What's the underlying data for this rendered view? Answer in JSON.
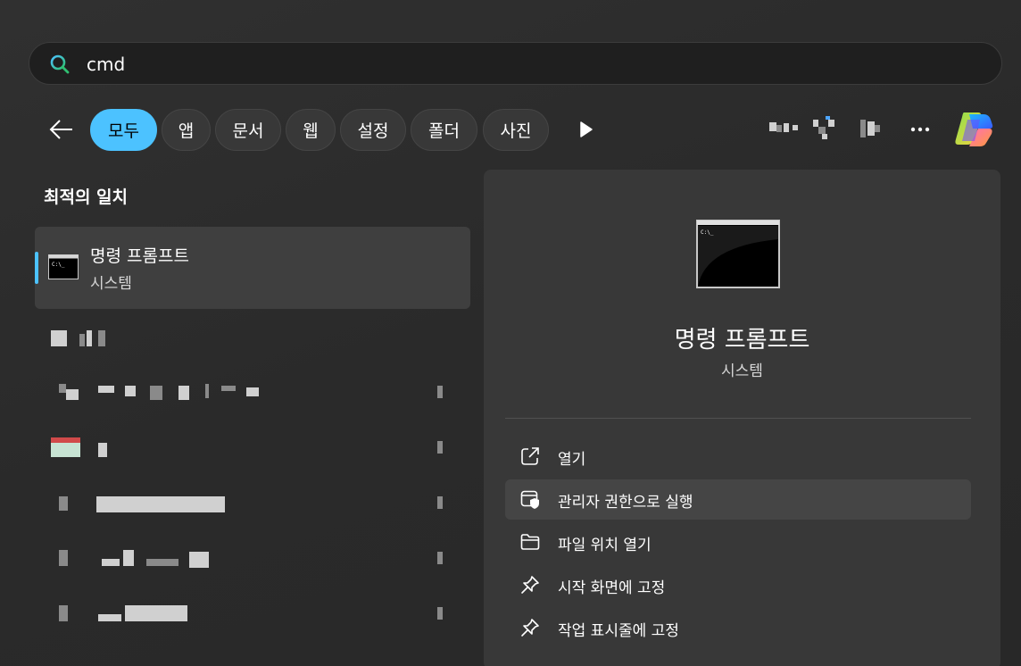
{
  "search": {
    "query": "cmd"
  },
  "filters": [
    "모두",
    "앱",
    "문서",
    "웹",
    "설정",
    "폴더",
    "사진"
  ],
  "best_match": {
    "section_title": "최적의 일치",
    "name": "명령 프롬프트",
    "type": "시스템"
  },
  "detail": {
    "title": "명령 프롬프트",
    "subtitle": "시스템",
    "actions": [
      {
        "label": "열기",
        "icon": "open-external-icon"
      },
      {
        "label": "관리자 권한으로 실행",
        "icon": "shield-window-icon"
      },
      {
        "label": "파일 위치 열기",
        "icon": "folder-icon"
      },
      {
        "label": "시작 화면에 고정",
        "icon": "pin-icon"
      },
      {
        "label": "작업 표시줄에 고정",
        "icon": "pin-icon"
      }
    ]
  },
  "colors": {
    "accent": "#4cc2ff",
    "panel": "#383838",
    "background": "#2b2b2b"
  }
}
